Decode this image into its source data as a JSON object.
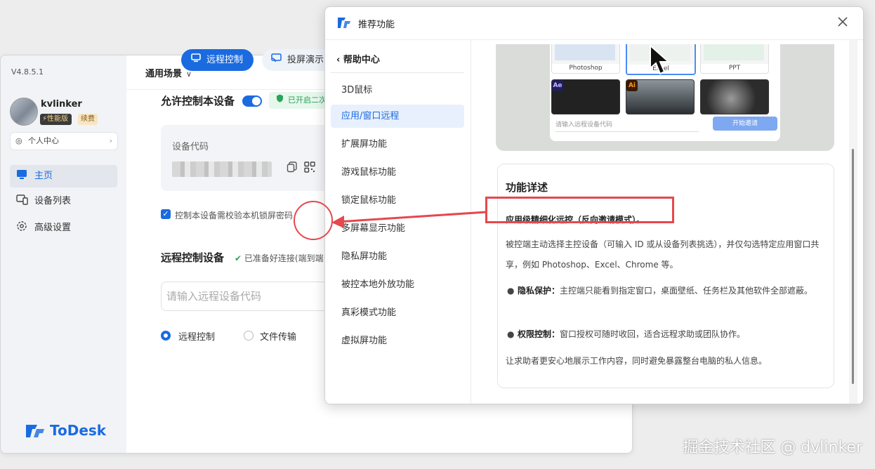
{
  "main_window": {
    "version": "V4.8.5.1",
    "user": {
      "name": "kvlinker",
      "badge_performance": "⚡性能版",
      "badge_renew": "续费"
    },
    "personal_center": "个人中心",
    "nav": [
      {
        "label": "主页",
        "icon": "monitor-icon"
      },
      {
        "label": "设备列表",
        "icon": "devices-icon"
      },
      {
        "label": "高级设置",
        "icon": "gear-icon"
      }
    ],
    "brand": "ToDesk",
    "scene": "通用场景",
    "tabs": {
      "remote": "远程控制",
      "cast": "投屏演示"
    },
    "allow_control": "允许控制本设备",
    "security_badge": "已开启二次",
    "device_code_label": "设备代码",
    "lock_check_label": "控制本设备需校验本机锁屏密码",
    "remote_device_label": "远程控制设备",
    "ready_text": "已准备好连接(端到端",
    "remote_input_placeholder": "请输入远程设备代码",
    "radios": {
      "remote": "远程控制",
      "file": "文件传输"
    }
  },
  "recommend_window": {
    "title": "推荐功能",
    "help_center": "帮助中心",
    "items": [
      "3D鼠标",
      "应用/窗口远程",
      "扩展屏功能",
      "游戏鼠标功能",
      "锁定鼠标功能",
      "多屏幕显示功能",
      "隐私屏功能",
      "被控本地外放功能",
      "真彩模式功能",
      "虚拟屏功能"
    ],
    "preview": {
      "thumbs": [
        "Photoshop",
        "Excel",
        "PPT"
      ],
      "app_badges": [
        "Ae",
        "Ai"
      ],
      "input_placeholder": "请输入远程设备代码",
      "button": "开始邀请"
    },
    "detail": {
      "title": "功能详述",
      "subtitle": "应用级精细化远控（反向邀请模式）。",
      "para1": "被控端主动选择主控设备（可输入 ID 或从设备列表挑选），并仅勾选特定应用窗口共享，例如 Photoshop、Excel、Chrome 等。",
      "bullet1_title": "隐私保护：",
      "bullet1_text": "主控端只能看到指定窗口，桌面壁纸、任务栏及其他软件全部遮蔽。",
      "bullet2_title": "权限控制：",
      "bullet2_text": "窗口授权可随时收回，适合远程求助或团队协作。",
      "para2": "让求助者更安心地展示工作内容，同时避免暴露整台电脑的私人信息。"
    }
  },
  "watermark": "掘金技术社区 @ dvlinker",
  "colors": {
    "accent": "#1a6be0",
    "annotation": "#e5484d",
    "success": "#2ba35a"
  }
}
